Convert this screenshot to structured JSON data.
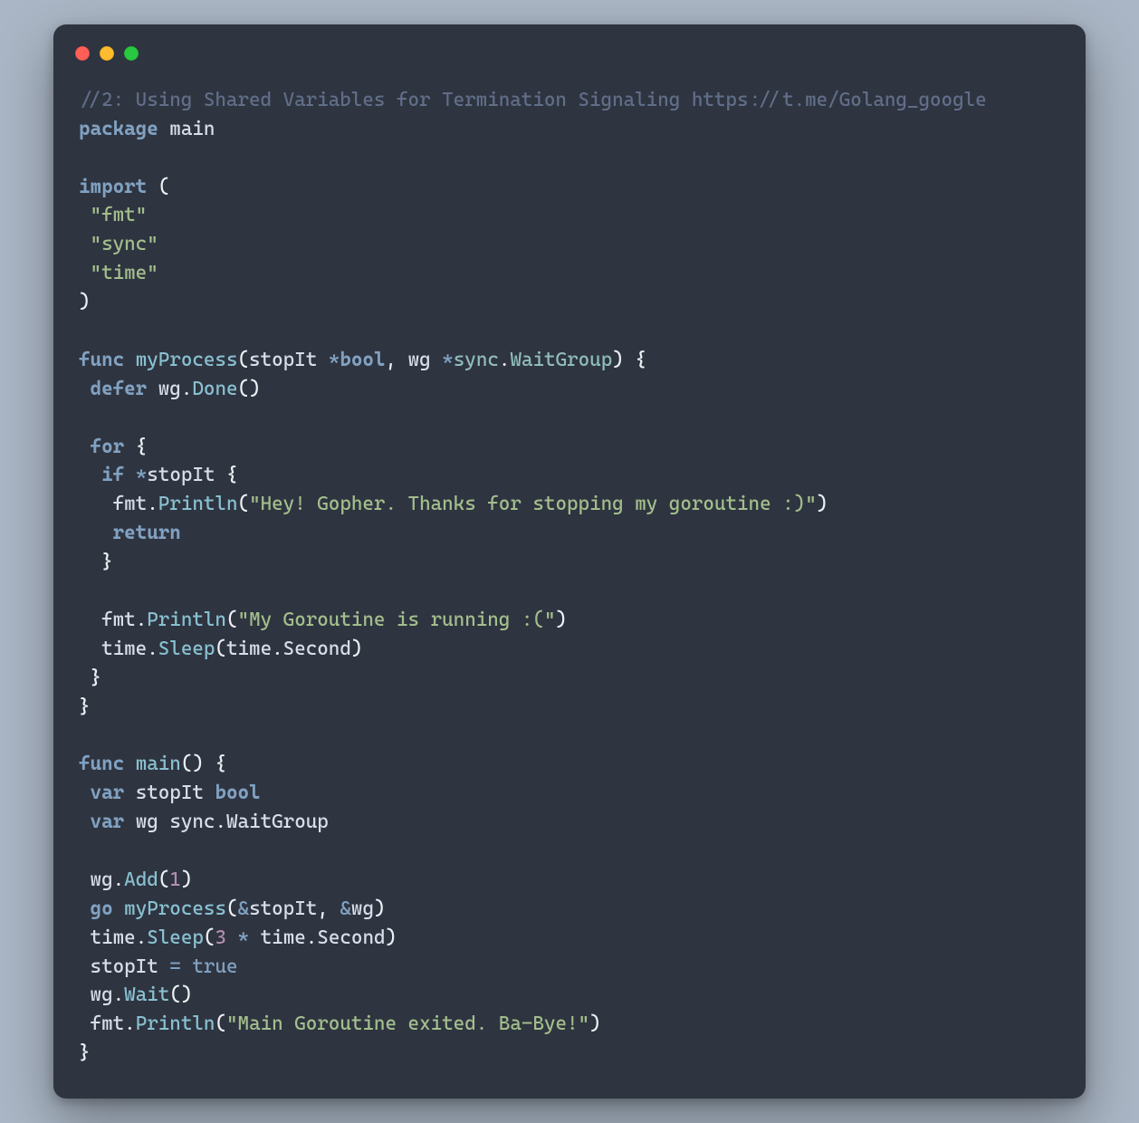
{
  "window": {
    "traffic_lights": [
      "red",
      "yellow",
      "green"
    ]
  },
  "code": {
    "comment": "//2: Using Shared Variables for Termination Signaling https://t.me/Golang_google",
    "kw_package": "package",
    "pkg_main": "main",
    "kw_import": "import",
    "import_fmt": "\"fmt\"",
    "import_sync": "\"sync\"",
    "import_time": "\"time\"",
    "kw_func": "func",
    "fn_myProcess": "myProcess",
    "param_stopIt": "stopIt",
    "ty_bool": "bool",
    "param_wg": "wg",
    "ty_sync": "sync",
    "ty_WaitGroup": "WaitGroup",
    "kw_defer": "defer",
    "id_wg": "wg",
    "fn_Done": "Done",
    "kw_for": "for",
    "kw_if": "if",
    "id_stopIt": "stopIt",
    "id_fmt": "fmt",
    "fn_Println": "Println",
    "str_thanks": "\"Hey! Gopher. Thanks for stopping my goroutine :)\"",
    "kw_return": "return",
    "str_running": "\"My Goroutine is running :(\"",
    "id_time": "time",
    "fn_Sleep": "Sleep",
    "id_Second": "Second",
    "fn_main": "main",
    "kw_var": "var",
    "fn_Add": "Add",
    "num_1": "1",
    "kw_go": "go",
    "num_3": "3",
    "lit_true": "true",
    "fn_Wait": "Wait",
    "str_exit": "\"Main Goroutine exited. Ba-Bye!\""
  }
}
